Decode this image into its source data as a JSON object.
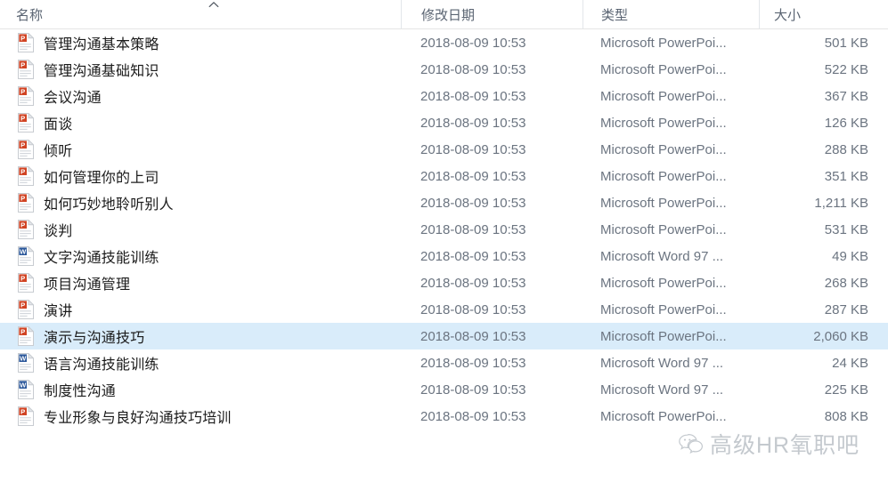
{
  "colors": {
    "selection": "#d9ecfa",
    "powerpoint": "#d14424",
    "word": "#2b579a",
    "header_text": "#5a6472",
    "body_text": "#6b7480",
    "name_text": "#1b1b1b",
    "separator": "#e3e6ea"
  },
  "header": {
    "columns": [
      {
        "label": "名称",
        "key": "name"
      },
      {
        "label": "修改日期",
        "key": "date"
      },
      {
        "label": "类型",
        "key": "type"
      },
      {
        "label": "大小",
        "key": "size"
      }
    ],
    "sort_column": "名称",
    "sort_direction": "ascending",
    "sort_icon": "chevron-up-icon"
  },
  "rows": [
    {
      "name": "管理沟通基本策略",
      "date": "2018-08-09 10:53",
      "type": "Microsoft PowerPoi...",
      "size": "501 KB",
      "icon": "powerpoint-file-icon",
      "selected": false
    },
    {
      "name": "管理沟通基础知识",
      "date": "2018-08-09 10:53",
      "type": "Microsoft PowerPoi...",
      "size": "522 KB",
      "icon": "powerpoint-file-icon",
      "selected": false
    },
    {
      "name": "会议沟通",
      "date": "2018-08-09 10:53",
      "type": "Microsoft PowerPoi...",
      "size": "367 KB",
      "icon": "powerpoint-file-icon",
      "selected": false
    },
    {
      "name": "面谈",
      "date": "2018-08-09 10:53",
      "type": "Microsoft PowerPoi...",
      "size": "126 KB",
      "icon": "powerpoint-file-icon",
      "selected": false
    },
    {
      "name": "倾听",
      "date": "2018-08-09 10:53",
      "type": "Microsoft PowerPoi...",
      "size": "288 KB",
      "icon": "powerpoint-file-icon",
      "selected": false
    },
    {
      "name": "如何管理你的上司",
      "date": "2018-08-09 10:53",
      "type": "Microsoft PowerPoi...",
      "size": "351 KB",
      "icon": "powerpoint-file-icon",
      "selected": false
    },
    {
      "name": "如何巧妙地聆听别人",
      "date": "2018-08-09 10:53",
      "type": "Microsoft PowerPoi...",
      "size": "1,211 KB",
      "icon": "powerpoint-file-icon",
      "selected": false
    },
    {
      "name": "谈判",
      "date": "2018-08-09 10:53",
      "type": "Microsoft PowerPoi...",
      "size": "531 KB",
      "icon": "powerpoint-file-icon",
      "selected": false
    },
    {
      "name": "文字沟通技能训练",
      "date": "2018-08-09 10:53",
      "type": "Microsoft Word 97 ...",
      "size": "49 KB",
      "icon": "word-file-icon",
      "selected": false
    },
    {
      "name": "项目沟通管理",
      "date": "2018-08-09 10:53",
      "type": "Microsoft PowerPoi...",
      "size": "268 KB",
      "icon": "powerpoint-file-icon",
      "selected": false
    },
    {
      "name": "演讲",
      "date": "2018-08-09 10:53",
      "type": "Microsoft PowerPoi...",
      "size": "287 KB",
      "icon": "powerpoint-file-icon",
      "selected": false
    },
    {
      "name": "演示与沟通技巧",
      "date": "2018-08-09 10:53",
      "type": "Microsoft PowerPoi...",
      "size": "2,060 KB",
      "icon": "powerpoint-file-icon",
      "selected": true
    },
    {
      "name": "语言沟通技能训练",
      "date": "2018-08-09 10:53",
      "type": "Microsoft Word 97 ...",
      "size": "24 KB",
      "icon": "word-file-icon",
      "selected": false
    },
    {
      "name": "制度性沟通",
      "date": "2018-08-09 10:53",
      "type": "Microsoft Word 97 ...",
      "size": "225 KB",
      "icon": "word-file-icon",
      "selected": false
    },
    {
      "name": "专业形象与良好沟通技巧培训",
      "date": "2018-08-09 10:53",
      "type": "Microsoft PowerPoi...",
      "size": "808 KB",
      "icon": "powerpoint-file-icon",
      "selected": false
    }
  ],
  "watermark": {
    "text": "高级HR氧职吧",
    "logo": "wechat-logo-icon"
  }
}
